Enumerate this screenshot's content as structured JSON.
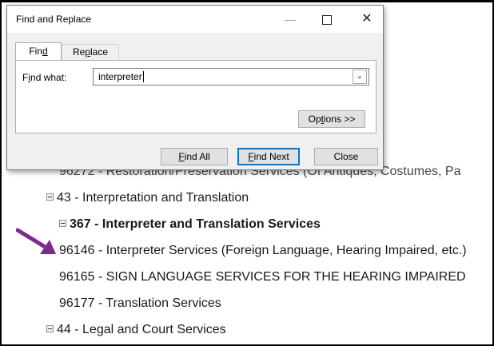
{
  "dialog": {
    "title": "Find and Replace",
    "controls": {
      "minimize": "—",
      "close": "✕"
    },
    "tabs": [
      {
        "pre": "Fin",
        "accel": "d",
        "post": ""
      },
      {
        "pre": "Re",
        "accel": "p",
        "post": "lace"
      }
    ],
    "find_what_label": {
      "pre": "F",
      "accel": "i",
      "post": "nd what:"
    },
    "find_what_value": "interpreter",
    "buttons": {
      "options": {
        "pre": "Op",
        "accel": "t",
        "post": "ions >>"
      },
      "find_all": {
        "pre": "",
        "accel": "F",
        "post": "ind All"
      },
      "find_next": {
        "pre": "",
        "accel": "F",
        "post": "ind Next"
      },
      "close": "Close"
    }
  },
  "tree": {
    "partial_row": "96272 - Restoration/Preservation Services (Of Antiques, Costumes, Pa",
    "rows": [
      {
        "text": "43 - Interpretation and Translation"
      },
      {
        "text": "367 - Interpreter and Translation Services"
      },
      {
        "text": "96146 - Interpreter Services (Foreign Language, Hearing Impaired, etc.)"
      },
      {
        "text": "96165 - SIGN LANGUAGE SERVICES FOR THE HEARING IMPAIRED"
      },
      {
        "text": "96177 - Translation Services"
      },
      {
        "text": "44 - Legal and Court Services"
      }
    ]
  },
  "colors": {
    "arrow": "#7b2a8e",
    "focus_border": "#0078d7"
  }
}
